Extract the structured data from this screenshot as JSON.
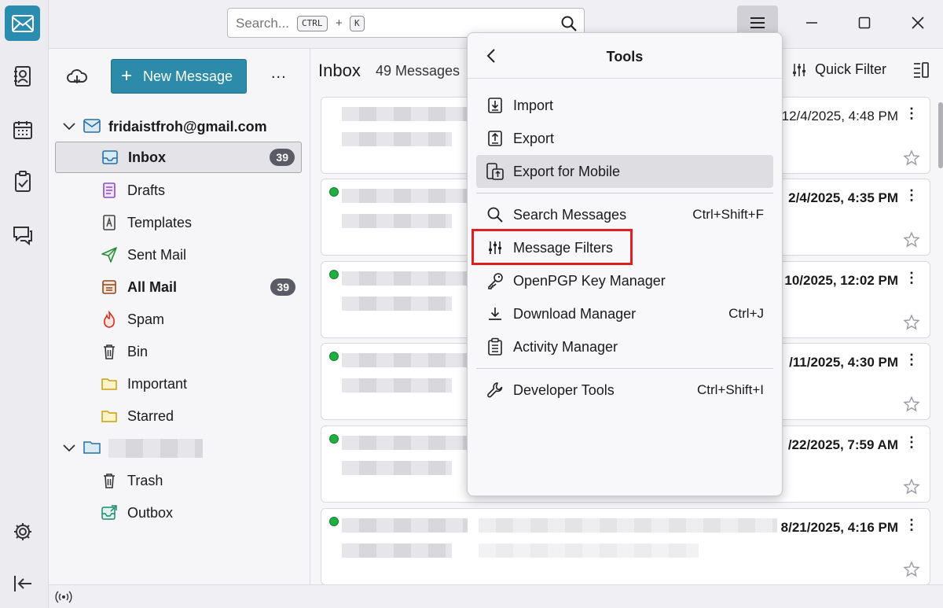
{
  "search": {
    "placeholder": "Search...",
    "kbd_ctrl": "CTRL",
    "kbd_plus": "+",
    "kbd_k": "K"
  },
  "folder_pane": {
    "new_message_label": "New Message",
    "more_label": "...",
    "account": "fridaistfroh@gmail.com",
    "folders": [
      {
        "label": "Inbox",
        "count": "39",
        "icon": "inbox-icon"
      },
      {
        "label": "Drafts",
        "icon": "drafts-icon"
      },
      {
        "label": "Templates",
        "icon": "templates-icon"
      },
      {
        "label": "Sent Mail",
        "icon": "sent-icon"
      },
      {
        "label": "All Mail",
        "count": "39",
        "icon": "all-mail-icon"
      },
      {
        "label": "Spam",
        "icon": "spam-icon"
      },
      {
        "label": "Bin",
        "icon": "bin-icon"
      },
      {
        "label": "Important",
        "icon": "folder-icon"
      },
      {
        "label": "Starred",
        "icon": "folder-icon"
      }
    ],
    "local_folders": [
      {
        "label": "Trash",
        "icon": "trash-icon"
      },
      {
        "label": "Outbox",
        "icon": "outbox-icon"
      }
    ]
  },
  "message_list": {
    "title": "Inbox",
    "count": "49 Messages",
    "quick_filter": "Quick Filter",
    "messages": [
      {
        "date": "12/4/2025, 4:48 PM",
        "unread": false
      },
      {
        "date": "2/4/2025, 4:35 PM",
        "unread": true
      },
      {
        "date": "10/2025, 12:02 PM",
        "unread": true
      },
      {
        "date": "/11/2025, 4:30 PM",
        "unread": true
      },
      {
        "date": "/22/2025, 7:59 AM",
        "unread": true
      },
      {
        "date": "8/21/2025, 4:16 PM",
        "unread": true
      }
    ]
  },
  "tools_menu": {
    "title": "Tools",
    "items": [
      {
        "label": "Import",
        "shortcut": "",
        "icon": "import-icon"
      },
      {
        "label": "Export",
        "shortcut": "",
        "icon": "export-icon"
      },
      {
        "label": "Export for Mobile",
        "shortcut": "",
        "icon": "export-mobile-icon"
      },
      {
        "label": "Search Messages",
        "shortcut": "Ctrl+Shift+F",
        "icon": "search-icon"
      },
      {
        "label": "Message Filters",
        "shortcut": "",
        "icon": "filter-icon"
      },
      {
        "label": "OpenPGP Key Manager",
        "shortcut": "",
        "icon": "key-icon"
      },
      {
        "label": "Download Manager",
        "shortcut": "Ctrl+J",
        "icon": "download-icon"
      },
      {
        "label": "Activity Manager",
        "shortcut": "",
        "icon": "activity-icon"
      },
      {
        "label": "Developer Tools",
        "shortcut": "Ctrl+Shift+I",
        "icon": "wrench-icon"
      }
    ]
  },
  "colors": {
    "accent": "#2b8ba8",
    "highlight": "#e02020",
    "unread_dot": "#20b040"
  }
}
